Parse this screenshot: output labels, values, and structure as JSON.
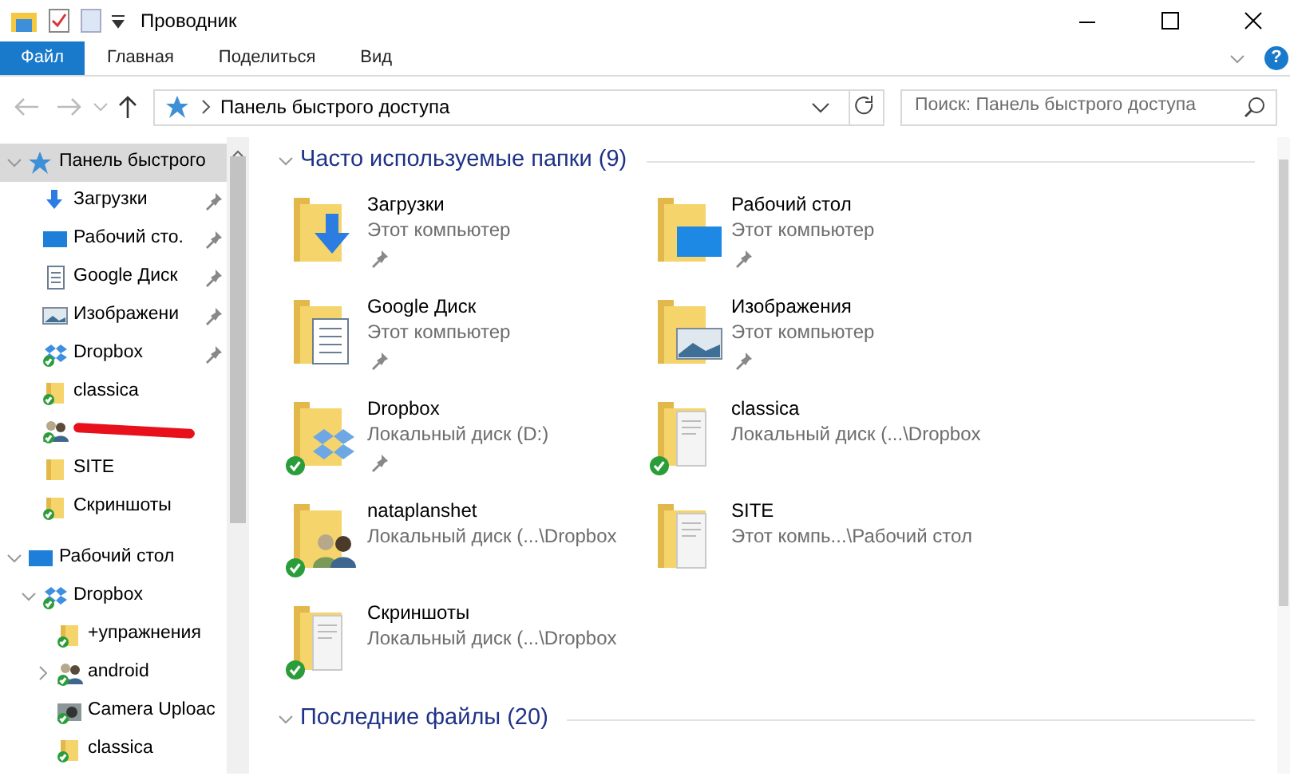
{
  "window": {
    "title": "Проводник"
  },
  "ribbon": {
    "tabs": [
      {
        "label": "Файл",
        "selected": true
      },
      {
        "label": "Главная",
        "selected": false
      },
      {
        "label": "Поделиться",
        "selected": false
      },
      {
        "label": "Вид",
        "selected": false
      }
    ],
    "help": "?"
  },
  "navigation": {
    "back_disabled": true,
    "forward_disabled": true
  },
  "address": {
    "path": "Панель быстрого доступа"
  },
  "search": {
    "placeholder": "Поиск: Панель быстрого доступа"
  },
  "sidebar": {
    "items": [
      {
        "label": "Панель быстрого",
        "kind": "star",
        "expanded": true,
        "selected": true,
        "children": [
          {
            "label": "Загрузки",
            "kind": "download",
            "pinned": true,
            "synced": false,
            "selected": false
          },
          {
            "label": "Рабочий сто.",
            "kind": "desktop",
            "pinned": true,
            "synced": false,
            "selected": false
          },
          {
            "label": "Google Диск",
            "kind": "doc",
            "pinned": true,
            "synced": false,
            "selected": false
          },
          {
            "label": "Изображени",
            "kind": "images",
            "pinned": true,
            "synced": false,
            "selected": false
          },
          {
            "label": "Dropbox",
            "kind": "dropbox",
            "pinned": true,
            "synced": true,
            "selected": false
          },
          {
            "label": "classica",
            "kind": "folder",
            "pinned": false,
            "synced": true,
            "selected": false
          },
          {
            "kind": "redacted",
            "pinned": false,
            "synced": true,
            "selected": false
          },
          {
            "label": "SITE",
            "kind": "folder",
            "pinned": false,
            "synced": false,
            "selected": false
          },
          {
            "label": "Скриншоты",
            "kind": "folder",
            "pinned": false,
            "synced": true,
            "selected": false
          }
        ]
      },
      {
        "label": "Рабочий стол",
        "kind": "desktop",
        "expanded": true,
        "selected": false,
        "children": [
          {
            "label": "Dropbox",
            "kind": "dropbox",
            "expanded": true,
            "synced": true,
            "selected": false,
            "children": [
              {
                "label": "+упражнения",
                "kind": "folder",
                "synced": true,
                "selected": false
              },
              {
                "label": "android",
                "kind": "people",
                "expanded": false,
                "synced": true,
                "selected": false
              },
              {
                "label": "Camera Uploac",
                "kind": "camera",
                "synced": true,
                "selected": false
              },
              {
                "label": "classica",
                "kind": "folder",
                "synced": true,
                "selected": false
              }
            ]
          }
        ]
      }
    ]
  },
  "groups": [
    {
      "title": "Часто используемые папки (9)",
      "expanded": true,
      "items": [
        {
          "name": "Загрузки",
          "location": "Этот компьютер",
          "kind": "download",
          "pinned": true,
          "synced": false
        },
        {
          "name": "Рабочий стол",
          "location": "Этот компьютер",
          "kind": "desktop",
          "pinned": true,
          "synced": false
        },
        {
          "name": "Google Диск",
          "location": "Этот компьютер",
          "kind": "doc",
          "pinned": true,
          "synced": false
        },
        {
          "name": "Изображения",
          "location": "Этот компьютер",
          "kind": "images",
          "pinned": true,
          "synced": false
        },
        {
          "name": "Dropbox",
          "location": "Локальный диск (D:)",
          "kind": "dropbox",
          "pinned": true,
          "synced": true
        },
        {
          "name": "classica",
          "location": "Локальный диск (...\\Dropbox",
          "kind": "paper",
          "pinned": false,
          "synced": true
        },
        {
          "name": "nataplanshet",
          "location": "Локальный диск (...\\Dropbox",
          "kind": "people",
          "pinned": false,
          "synced": true
        },
        {
          "name": "SITE",
          "location": "Этот компь...\\Рабочий стол",
          "kind": "paper",
          "pinned": false,
          "synced": false
        },
        {
          "name": "Скриншоты",
          "location": "Локальный диск (...\\Dropbox",
          "kind": "paper",
          "pinned": false,
          "synced": true
        }
      ]
    },
    {
      "title": "Последние файлы (20)",
      "expanded": true
    }
  ]
}
